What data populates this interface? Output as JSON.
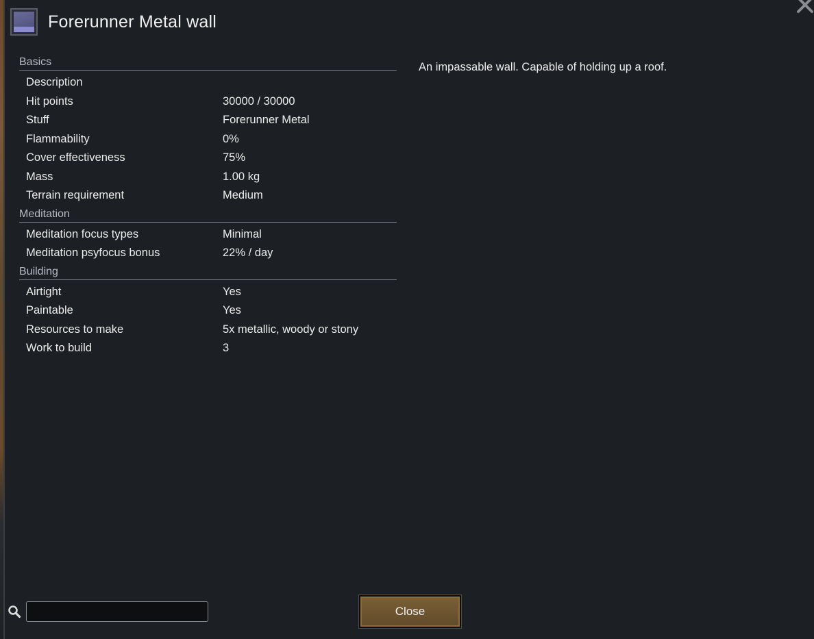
{
  "window": {
    "title": "Forerunner Metal wall",
    "icon": "forerunner-metal-wall-icon",
    "close_icon": "close-x-icon"
  },
  "stats": {
    "sections": [
      {
        "heading": "Basics",
        "rows": [
          {
            "label": "Description",
            "value": ""
          },
          {
            "label": "Hit points",
            "value": "30000 / 30000"
          },
          {
            "label": "Stuff",
            "value": "Forerunner Metal"
          },
          {
            "label": "Flammability",
            "value": "0%"
          },
          {
            "label": "Cover effectiveness",
            "value": "75%"
          },
          {
            "label": "Mass",
            "value": "1.00 kg"
          },
          {
            "label": "Terrain requirement",
            "value": "Medium"
          }
        ]
      },
      {
        "heading": "Meditation",
        "rows": [
          {
            "label": "Meditation focus types",
            "value": "Minimal"
          },
          {
            "label": "Meditation psyfocus bonus",
            "value": "22% / day"
          }
        ]
      },
      {
        "heading": "Building",
        "rows": [
          {
            "label": "Airtight",
            "value": "Yes"
          },
          {
            "label": "Paintable",
            "value": "Yes"
          },
          {
            "label": "Resources to make",
            "value": "5x metallic, woody or stony"
          },
          {
            "label": "Work to build",
            "value": "3"
          }
        ]
      }
    ]
  },
  "description": "An impassable wall. Capable of holding up a roof.",
  "search": {
    "icon": "search-icon",
    "value": "",
    "placeholder": ""
  },
  "footer": {
    "close_label": "Close"
  },
  "colors": {
    "background": "#1c1f23",
    "button": "#6e5530",
    "section_rule": "#7c8086"
  }
}
